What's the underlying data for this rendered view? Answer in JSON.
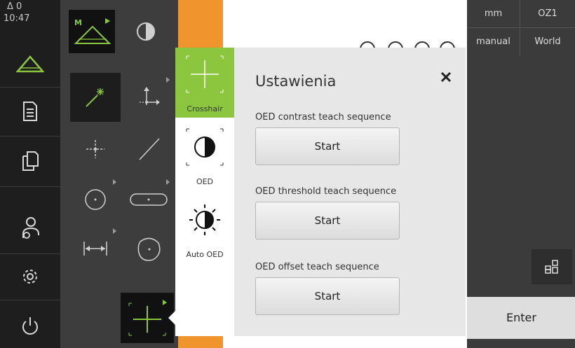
{
  "status": {
    "delta": "Δ 0",
    "time": "10:47"
  },
  "right_panel": {
    "unit": "mm",
    "reference": "OZ1",
    "mode": "manual",
    "coord": "World",
    "enter_label": "Enter"
  },
  "popup": {
    "title": "Ustawienia",
    "tabs": [
      {
        "label": "Crosshair"
      },
      {
        "label": "OED"
      },
      {
        "label": "Auto OED"
      }
    ],
    "sections": [
      {
        "label": "OED contrast teach sequence",
        "button": "Start"
      },
      {
        "label": "OED threshold teach sequence",
        "button": "Start"
      },
      {
        "label": "OED offset teach sequence",
        "button": "Start"
      }
    ]
  },
  "colors": {
    "accent_green": "#8cc63f",
    "orange": "#f0942e"
  }
}
